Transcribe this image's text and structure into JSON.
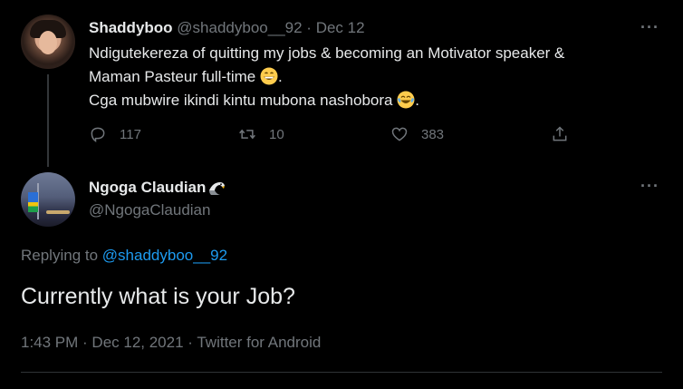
{
  "parent_tweet": {
    "author_name": "Shaddyboo",
    "handle": "@shaddyboo__92",
    "separator": "·",
    "date": "Dec 12",
    "line1": "Ndigutekereza of quitting my jobs & becoming an Motivator  speaker &",
    "line2": "Maman Pasteur  full-time",
    "line2_end": ".",
    "line3": "Cga mubwire ikindi kintu mubona nashobora",
    "line3_end": ".",
    "emoji1": "grinning-face-emoji",
    "emoji2": "tears-of-joy-emoji",
    "reply_count": "117",
    "retweet_count": "10",
    "like_count": "383",
    "more_glyph": "···"
  },
  "focused_tweet": {
    "author_name": "Ngoga Claudian",
    "author_emoji": "eagle-emoji",
    "handle": "@NgogaClaudian",
    "replying_prefix": "Replying to",
    "replying_handle": "@shaddyboo__92",
    "text": "Currently what is your Job?",
    "meta": "1:43 PM · Dec 12, 2021 · Twitter for Android",
    "more_glyph": "···"
  },
  "colors": {
    "background": "#000000",
    "text": "#e7e9ea",
    "muted": "#71767b",
    "link": "#1d9bf0",
    "border": "#2f3336"
  }
}
